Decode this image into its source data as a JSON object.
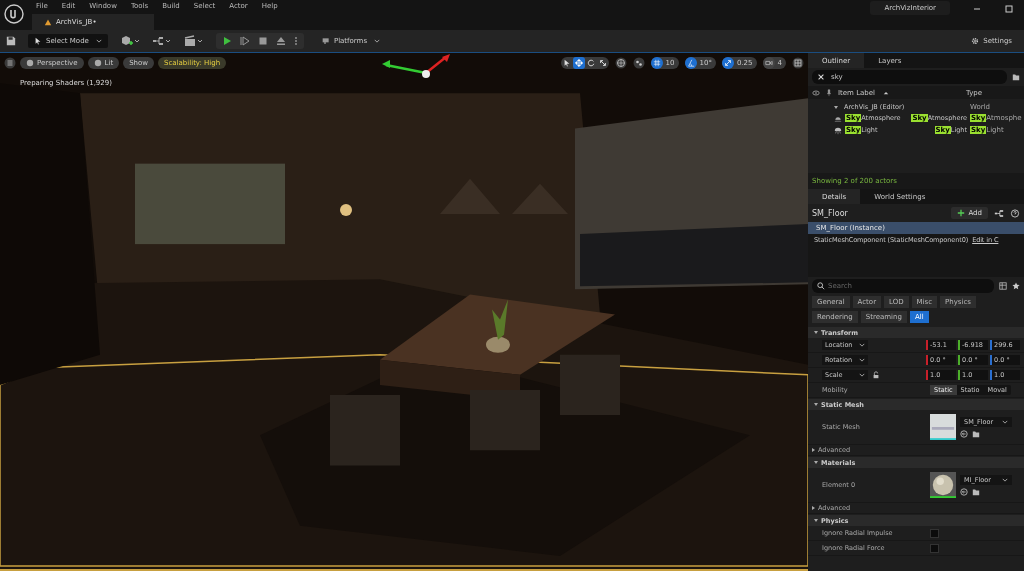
{
  "menu": [
    "File",
    "Edit",
    "Window",
    "Tools",
    "Build",
    "Select",
    "Actor",
    "Help"
  ],
  "document_tab": {
    "label": "ArchVis_JB•",
    "selected": true
  },
  "project_name": "ArchVizInterior",
  "toolbar": {
    "select_mode": "Select Mode",
    "platforms": "Platforms",
    "settings": "Settings"
  },
  "viewport": {
    "buttons": [
      {
        "label": "Perspective",
        "kind": "plain"
      },
      {
        "label": "Lit",
        "kind": "plain"
      },
      {
        "label": "Show",
        "kind": "plain"
      },
      {
        "label": "Scalability: High",
        "kind": "warning"
      }
    ],
    "status": "Preparing Shaders (1,929)",
    "transform_tools": [
      {
        "kind": "select",
        "selected": false
      },
      {
        "kind": "move",
        "selected": true
      },
      {
        "kind": "rotate",
        "selected": false
      },
      {
        "kind": "scale",
        "selected": false
      }
    ],
    "snaps": [
      {
        "kind": "grid",
        "value": "10",
        "on": true
      },
      {
        "kind": "angle",
        "value": "10°",
        "on": true
      },
      {
        "kind": "scale",
        "value": "0.25",
        "on": true
      },
      {
        "kind": "camera",
        "value": "4",
        "on": false
      }
    ]
  },
  "outliner": {
    "tabs": [
      {
        "label": "Outliner",
        "selected": true
      },
      {
        "label": "Layers",
        "selected": false
      }
    ],
    "search": "sky",
    "columns": [
      "Item Label",
      "Type"
    ],
    "tree": [
      {
        "label": "ArchVis_JB (Editor)",
        "type": "World",
        "expanded": true,
        "children": [
          {
            "match": "Sky",
            "rest": "Atmosphere",
            "extra_match": "Sky",
            "extra_rest": "Atmosphere",
            "type_match": "Sky",
            "type_rest": "Atmosphe",
            "kind": "atmosphere"
          },
          {
            "match": "Sky",
            "rest": "Light",
            "extra_match": "Sky",
            "extra_rest": "Light",
            "type_match": "Sky",
            "type_rest": "Light",
            "kind": "light"
          }
        ]
      }
    ],
    "footer": "Showing 2 of 200 actors"
  },
  "details": {
    "tabs": [
      {
        "label": "Details",
        "selected": true
      },
      {
        "label": "World Settings",
        "selected": false
      }
    ],
    "actor": "SM_Floor",
    "add_button": "Add",
    "components": [
      {
        "label": "SM_Floor (Instance)",
        "selected": true
      },
      {
        "label": "StaticMeshComponent (StaticMeshComponent0)",
        "selected": false,
        "link": "Edit in C"
      }
    ],
    "search_placeholder": "Search",
    "filters": [
      [
        {
          "label": "General",
          "selected": false
        },
        {
          "label": "Actor",
          "selected": false
        },
        {
          "label": "LOD",
          "selected": false
        },
        {
          "label": "Misc",
          "selected": false
        },
        {
          "label": "Physics",
          "selected": false
        }
      ],
      [
        {
          "label": "Rendering",
          "selected": false
        },
        {
          "label": "Streaming",
          "selected": false
        },
        {
          "label": "All",
          "selected": true
        }
      ]
    ],
    "sections": [
      {
        "title": "Transform",
        "expanded": true,
        "rows": [
          {
            "kind": "vector",
            "label": "Location",
            "values": [
              "-53.1",
              "-6.918",
              "299.6"
            ],
            "lock": false
          },
          {
            "kind": "vector",
            "label": "Rotation",
            "values": [
              "0.0 °",
              "0.0 °",
              "0.0 °"
            ],
            "lock": false
          },
          {
            "kind": "vector",
            "label": "Scale",
            "values": [
              "1.0",
              "1.0",
              "1.0"
            ],
            "lock": true
          },
          {
            "kind": "segmented",
            "label": "Mobility",
            "options": [
              {
                "label": "Static",
                "selected": true
              },
              {
                "label": "Statio",
                "selected": false
              },
              {
                "label": "Moval",
                "selected": false
              }
            ]
          }
        ]
      },
      {
        "title": "Static Mesh",
        "expanded": true,
        "rows": [
          {
            "kind": "mesh_asset",
            "label": "Static Mesh",
            "asset": "SM_Floor"
          },
          {
            "kind": "advanced",
            "label": "Advanced"
          }
        ]
      },
      {
        "title": "Materials",
        "expanded": true,
        "rows": [
          {
            "kind": "material_asset",
            "label": "Element 0",
            "asset": "MI_Floor"
          },
          {
            "kind": "advanced",
            "label": "Advanced"
          }
        ]
      },
      {
        "title": "Physics",
        "expanded": true,
        "rows": [
          {
            "kind": "check",
            "label": "Ignore Radial Impulse",
            "checked": false
          },
          {
            "kind": "check",
            "label": "Ignore Radial Force",
            "checked": false
          }
        ]
      }
    ]
  }
}
